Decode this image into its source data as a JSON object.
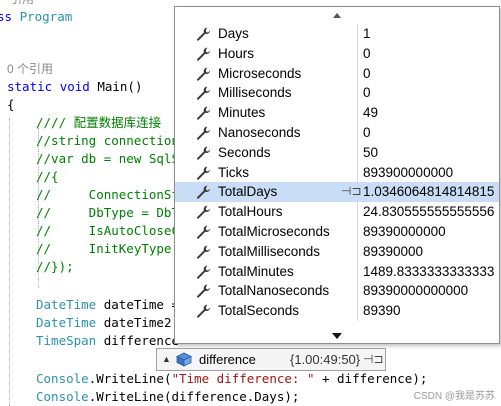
{
  "code": {
    "line_top_partial": "引用",
    "class_decl_kw": "ss ",
    "class_decl_name": "Program",
    "ref_count": "0 个引用",
    "main_static": "static",
    "main_void": "void",
    "main_name": "Main()",
    "brace_open": "{",
    "c1": "//// 配置数据库连接",
    "c2": "//string connection",
    "c3": "//var db = new SqlS",
    "c4": "//{",
    "c5": "//     ConnectionStr",
    "c6": "//     DbType = DbTy",
    "c7": "//     IsAutoCloseCo",
    "c8": "//     InitKeyType =",
    "c9": "//});",
    "dt1_type": "DateTime",
    "dt1_rest": " dateTime =",
    "dt2_type": "DateTime",
    "dt2_rest": " dateTime2",
    "ts_type": "TimeSpan",
    "ts_rest": " difference",
    "cw1_obj": "Console",
    "cw1_method": ".WriteLine(",
    "cw1_str": "\"Time difference: \"",
    "cw1_rest": " + difference);",
    "cw2_obj": "Console",
    "cw2_rest": ".WriteLine(difference.Days);"
  },
  "datatip": {
    "rows": [
      {
        "name": "Days",
        "value": "1"
      },
      {
        "name": "Hours",
        "value": "0"
      },
      {
        "name": "Microseconds",
        "value": "0"
      },
      {
        "name": "Milliseconds",
        "value": "0"
      },
      {
        "name": "Minutes",
        "value": "49"
      },
      {
        "name": "Nanoseconds",
        "value": "0"
      },
      {
        "name": "Seconds",
        "value": "50"
      },
      {
        "name": "Ticks",
        "value": "893900000000"
      },
      {
        "name": "TotalDays",
        "value": "1.0346064814814815"
      },
      {
        "name": "TotalHours",
        "value": "24.830555555555556"
      },
      {
        "name": "TotalMicroseconds",
        "value": "89390000000"
      },
      {
        "name": "TotalMilliseconds",
        "value": "89390000"
      },
      {
        "name": "TotalMinutes",
        "value": "1489.8333333333333"
      },
      {
        "name": "TotalNanoseconds",
        "value": "89390000000000"
      },
      {
        "name": "TotalSeconds",
        "value": "89390"
      }
    ],
    "selected_row": "TotalDays",
    "icon": "wrench-icon"
  },
  "hovertip": {
    "expand_glyph": "▲",
    "name": "difference",
    "value": "{1.00:49:50}",
    "pin_glyph": "⊣⊐",
    "icon": "variable-cube-icon"
  },
  "watermark": "CSDN @我是苏苏",
  "colors": {
    "keyword": "#0000ff",
    "comment": "#008000",
    "type": "#2b91af",
    "string": "#a31515",
    "selection": "#c9ddf6"
  }
}
